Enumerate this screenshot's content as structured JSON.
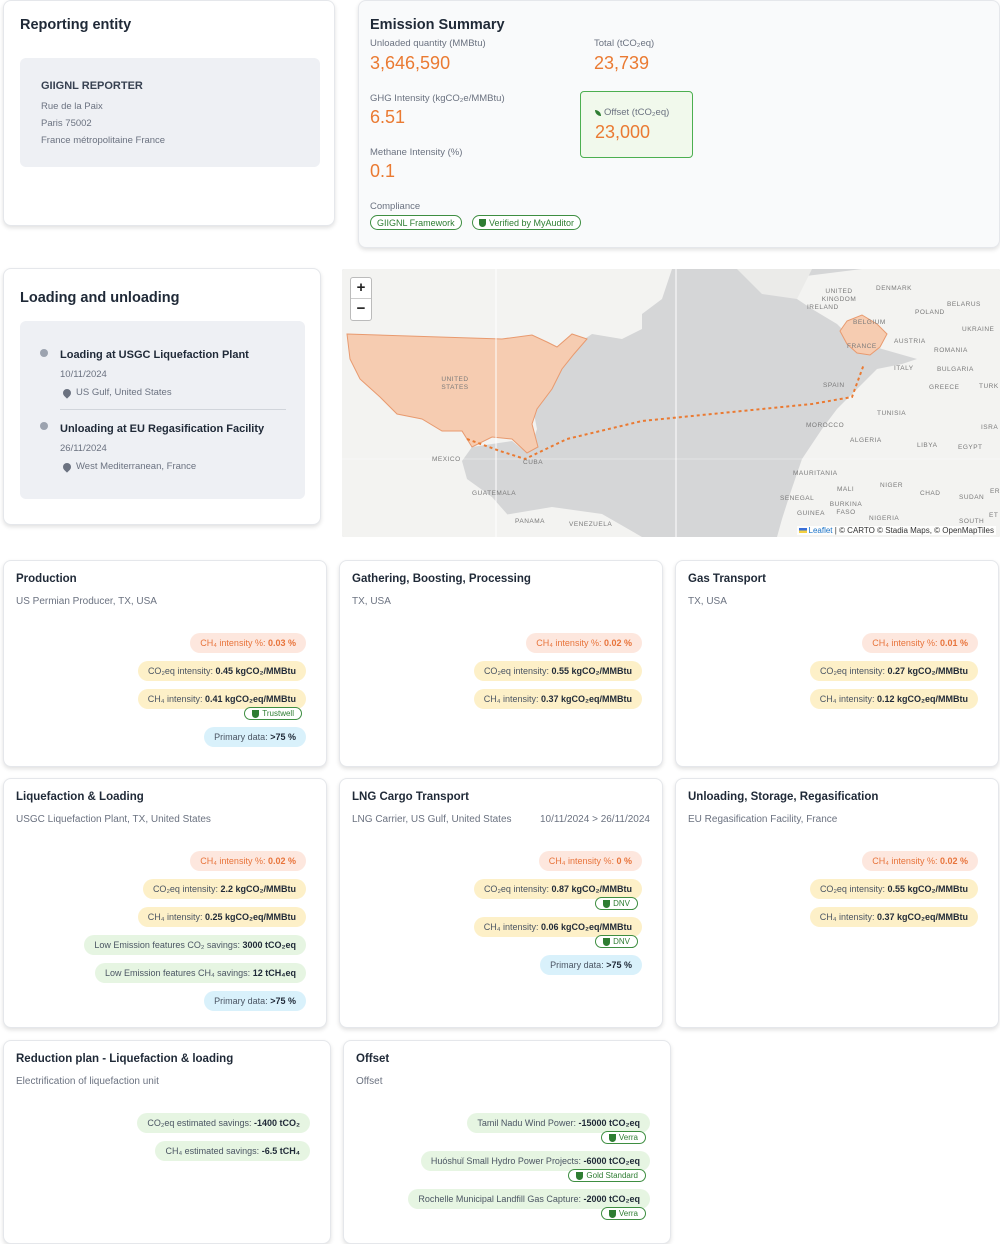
{
  "reporting": {
    "title": "Reporting entity",
    "name": "GIIGNL REPORTER",
    "address1": "Rue de la Paix",
    "address2": "Paris 75002",
    "address3": "France métropolitaine France"
  },
  "summary": {
    "title": "Emission Summary",
    "unloaded_label": "Unloaded quantity (MMBtu)",
    "unloaded_value": "3,646,590",
    "total_label": "Total (tCO₂eq)",
    "total_value": "23,739",
    "ghg_label": "GHG Intensity (kgCO₂e/MMBtu)",
    "ghg_value": "6.51",
    "offset_label": "Offset (tCO₂eq)",
    "offset_value": "23,000",
    "methane_label": "Methane Intensity (%)",
    "methane_value": "0.1",
    "compliance_label": "Compliance",
    "compliance_1": "GIIGNL Framework",
    "compliance_2": "Verified by MyAuditor"
  },
  "loading": {
    "title": "Loading and unloading",
    "items": [
      {
        "title": "Loading at USGC Liquefaction Plant",
        "date": "10/11/2024",
        "location": "US Gulf, United States"
      },
      {
        "title": "Unloading at EU Regasification Facility",
        "date": "26/11/2024",
        "location": "West Mediterranean, France"
      }
    ]
  },
  "map": {
    "zoom_in": "+",
    "zoom_out": "−",
    "attribution_prefix": "Leaflet",
    "attribution_rest": "| © CARTO © Stadia Maps, © OpenMapTiles",
    "labels": {
      "us": "UNITED STATES",
      "mexico": "MEXICO",
      "cuba": "CUBA",
      "guatemala": "GUATEMALA",
      "panama": "PANAMA",
      "venezuela": "VENEZUELA",
      "uk": "UNITED KINGDOM",
      "ireland": "IRELAND",
      "denmark": "DENMARK",
      "belarus": "BELARUS",
      "poland": "POLAND",
      "belgium": "BELGIUM",
      "ukraine": "UKRAINE",
      "austria": "AUSTRIA",
      "france": "FRANCE",
      "romania": "ROMANIA",
      "italy": "ITALY",
      "bulgaria": "BULGARIA",
      "spain": "SPAIN",
      "greece": "GREECE",
      "turk": "TURK",
      "tunisia": "TUNISIA",
      "morocco": "MOROCCO",
      "algeria": "ALGERIA",
      "libya": "LIBYA",
      "egypt": "EGYPT",
      "isra": "ISRA",
      "mauritania": "MAURITANIA",
      "mali": "MALI",
      "niger": "NIGER",
      "chad": "CHAD",
      "sudan": "SUDAN",
      "senegal": "SENEGAL",
      "burkina": "BURKINA FASO",
      "guinea": "GUINEA",
      "nigeria": "NIGERIA",
      "south": "SOUTH",
      "er": "ER",
      "et": "ET"
    }
  },
  "cards": [
    {
      "title": "Production",
      "sub": "US Permian Producer, TX, USA",
      "sub_right": "",
      "tags": [
        {
          "color": "red",
          "label": "CH₄ intensity %:",
          "value": "0.03 %",
          "badge": ""
        },
        {
          "color": "yel",
          "label": "CO₂eq intensity:",
          "value": "0.45 kgCO₂/MMBtu",
          "badge": ""
        },
        {
          "color": "yel",
          "label": "CH₄ intensity:",
          "value": "0.41 kgCO₂eq/MMBtu",
          "badge": "Trustwell"
        },
        {
          "color": "blu",
          "label": "Primary data:",
          "value": ">75 %",
          "badge": ""
        }
      ]
    },
    {
      "title": "Gathering, Boosting, Processing",
      "sub": "TX, USA",
      "sub_right": "",
      "tags": [
        {
          "color": "red",
          "label": "CH₄ intensity %:",
          "value": "0.02 %",
          "badge": ""
        },
        {
          "color": "yel",
          "label": "CO₂eq intensity:",
          "value": "0.55 kgCO₂/MMBtu",
          "badge": ""
        },
        {
          "color": "yel",
          "label": "CH₄ intensity:",
          "value": "0.37 kgCO₂eq/MMBtu",
          "badge": ""
        }
      ]
    },
    {
      "title": "Gas Transport",
      "sub": "TX, USA",
      "sub_right": "",
      "tags": [
        {
          "color": "red",
          "label": "CH₄ intensity %:",
          "value": "0.01 %",
          "badge": ""
        },
        {
          "color": "yel",
          "label": "CO₂eq intensity:",
          "value": "0.27 kgCO₂/MMBtu",
          "badge": ""
        },
        {
          "color": "yel",
          "label": "CH₄ intensity:",
          "value": "0.12 kgCO₂eq/MMBtu",
          "badge": ""
        }
      ]
    },
    {
      "title": "Liquefaction & Loading",
      "sub": "USGC Liquefaction Plant, TX, United States",
      "sub_right": "",
      "tags": [
        {
          "color": "red",
          "label": "CH₄ intensity %:",
          "value": "0.02 %",
          "badge": ""
        },
        {
          "color": "yel",
          "label": "CO₂eq intensity:",
          "value": "2.2 kgCO₂/MMBtu",
          "badge": ""
        },
        {
          "color": "yel",
          "label": "CH₄ intensity:",
          "value": "0.25 kgCO₂eq/MMBtu",
          "badge": ""
        },
        {
          "color": "grn",
          "label": "Low Emission features CO₂ savings:",
          "value": "3000 tCO₂eq",
          "badge": ""
        },
        {
          "color": "grn",
          "label": "Low Emission features CH₄ savings:",
          "value": "12 tCH₄eq",
          "badge": ""
        },
        {
          "color": "blu",
          "label": "Primary data:",
          "value": ">75 %",
          "badge": ""
        }
      ]
    },
    {
      "title": "LNG Cargo Transport",
      "sub": "LNG Carrier, US Gulf, United States",
      "sub_right": "10/11/2024 > 26/11/2024",
      "tags": [
        {
          "color": "red",
          "label": "CH₄ intensity %:",
          "value": "0 %",
          "badge": ""
        },
        {
          "color": "yel",
          "label": "CO₂eq intensity:",
          "value": "0.87 kgCO₂/MMBtu",
          "badge": "DNV"
        },
        {
          "color": "yel",
          "label": "CH₄ intensity:",
          "value": "0.06 kgCO₂eq/MMBtu",
          "badge": "DNV"
        },
        {
          "color": "blu",
          "label": "Primary data:",
          "value": ">75 %",
          "badge": ""
        }
      ]
    },
    {
      "title": "Unloading, Storage, Regasification",
      "sub": "EU Regasification Facility, France",
      "sub_right": "",
      "tags": [
        {
          "color": "red",
          "label": "CH₄ intensity %:",
          "value": "0.02 %",
          "badge": ""
        },
        {
          "color": "yel",
          "label": "CO₂eq intensity:",
          "value": "0.55 kgCO₂/MMBtu",
          "badge": ""
        },
        {
          "color": "yel",
          "label": "CH₄ intensity:",
          "value": "0.37 kgCO₂eq/MMBtu",
          "badge": ""
        }
      ]
    },
    {
      "title": "Reduction plan - Liquefaction & loading",
      "sub": "Electrification of liquefaction unit",
      "sub_right": "",
      "tags": [
        {
          "color": "grn",
          "label": "CO₂eq estimated savings:",
          "value": "-1400 tCO₂",
          "badge": ""
        },
        {
          "color": "grn",
          "label": "CH₄ estimated savings:",
          "value": "-6.5 tCH₄",
          "badge": ""
        }
      ]
    },
    {
      "title": "Offset",
      "sub": "Offset",
      "sub_right": "",
      "tags": [
        {
          "color": "grn",
          "label": "Tamil Nadu Wind Power:",
          "value": "-15000 tCO₂eq",
          "badge": "Verra"
        },
        {
          "color": "grn",
          "label": "Huóshuǐ Small Hydro Power Projects:",
          "value": "-6000 tCO₂eq",
          "badge": "Gold Standard"
        },
        {
          "color": "grn",
          "label": "Rochelle Municipal Landfill Gas Capture:",
          "value": "-2000 tCO₂eq",
          "badge": "Verra"
        }
      ]
    }
  ]
}
